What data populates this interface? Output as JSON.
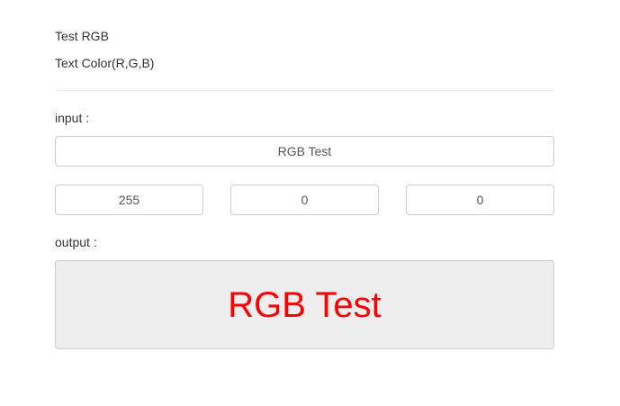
{
  "header": {
    "title": "Test RGB",
    "subtitle": "Text Color(R,G,B)"
  },
  "input_section": {
    "label": "input :",
    "text_value": "RGB Test",
    "red_value": "255",
    "green_value": "0",
    "blue_value": "0"
  },
  "output_section": {
    "label": "output :",
    "text": "RGB Test",
    "text_color": "#ff0000",
    "box_background": "#eeeeee"
  }
}
